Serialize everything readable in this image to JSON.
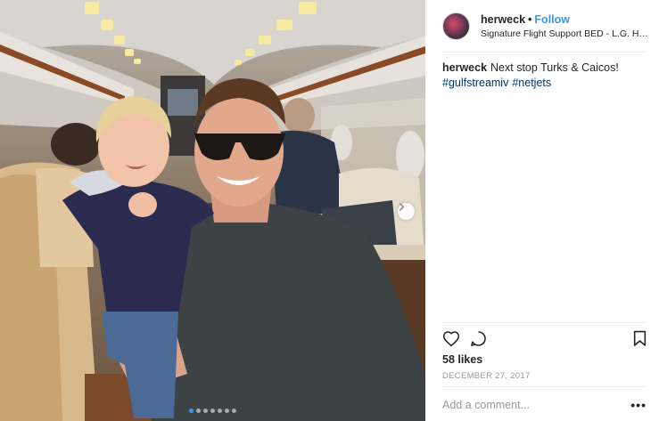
{
  "post": {
    "username": "herweck",
    "separator": "•",
    "follow_label": "Follow",
    "location": "Signature Flight Support BED - L.G. Ha...",
    "caption_user": "herweck",
    "caption_text": "Next stop Turks & Caicos!",
    "hashtags": [
      "#gulfstreamiv",
      "#netjets"
    ],
    "likes": "58 likes",
    "date": "DECEMBER 27, 2017",
    "comment_placeholder": "Add a comment...",
    "more_label": "•••"
  },
  "carousel": {
    "slide_count": 7,
    "active_index": 0
  },
  "icons": {
    "like": "heart-icon",
    "comment": "comment-bubble-icon",
    "save": "bookmark-icon",
    "next": "chevron-right-icon"
  },
  "colors": {
    "accent": "#3897f0",
    "hashtag": "#003569",
    "muted": "#999999",
    "text": "#262626"
  }
}
